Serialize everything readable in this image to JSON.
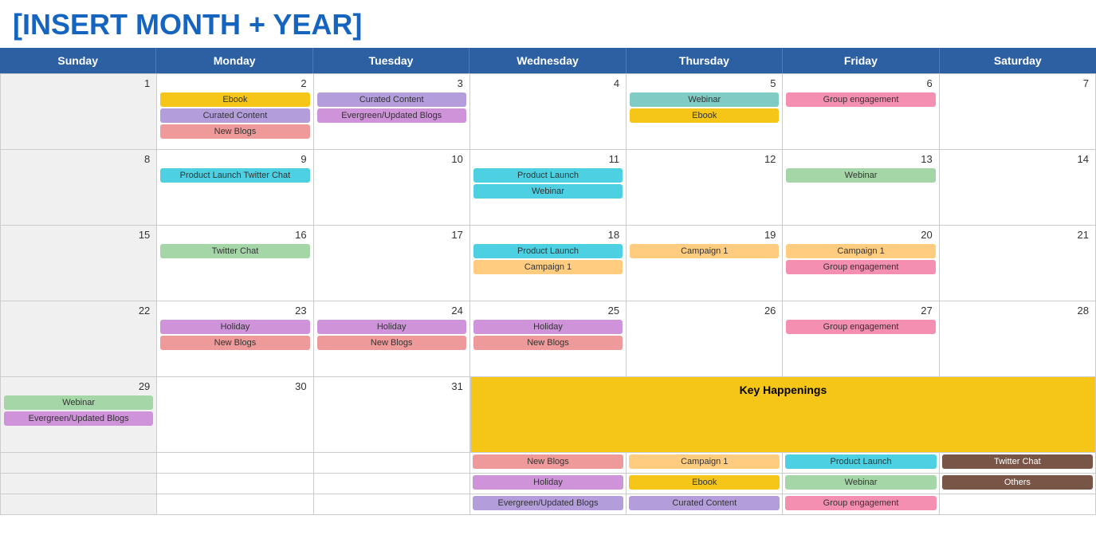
{
  "title": "[INSERT MONTH + YEAR]",
  "days": [
    "Sunday",
    "Monday",
    "Tuesday",
    "Wednesday",
    "Thursday",
    "Friday",
    "Saturday"
  ],
  "weeks": [
    {
      "cells": [
        {
          "date": "1",
          "events": []
        },
        {
          "date": "2",
          "events": [
            {
              "label": "Ebook",
              "color": "ev-yellow"
            },
            {
              "label": "Curated Content",
              "color": "ev-purple"
            },
            {
              "label": "New Blogs",
              "color": "ev-salmon"
            }
          ]
        },
        {
          "date": "3",
          "events": [
            {
              "label": "Curated Content",
              "color": "ev-purple"
            },
            {
              "label": "Evergreen/Updated Blogs",
              "color": "ev-lavender"
            }
          ]
        },
        {
          "date": "4",
          "events": []
        },
        {
          "date": "5",
          "events": [
            {
              "label": "Webinar",
              "color": "ev-green"
            },
            {
              "label": "Ebook",
              "color": "ev-yellow"
            }
          ]
        },
        {
          "date": "6",
          "events": [
            {
              "label": "Group engagement",
              "color": "ev-pink"
            }
          ]
        },
        {
          "date": "7",
          "events": []
        }
      ]
    },
    {
      "cells": [
        {
          "date": "8",
          "events": []
        },
        {
          "date": "9",
          "events": [
            {
              "label": "Product Launch Twitter Chat",
              "color": "ev-teal"
            }
          ]
        },
        {
          "date": "10",
          "events": []
        },
        {
          "date": "11",
          "events": [
            {
              "label": "Product Launch",
              "color": "ev-teal"
            },
            {
              "label": "Webinar",
              "color": "ev-teal"
            }
          ]
        },
        {
          "date": "12",
          "events": []
        },
        {
          "date": "13",
          "events": [
            {
              "label": "Webinar",
              "color": "ev-light-green"
            }
          ]
        },
        {
          "date": "14",
          "events": []
        }
      ]
    },
    {
      "cells": [
        {
          "date": "15",
          "events": []
        },
        {
          "date": "16",
          "events": [
            {
              "label": "Twitter Chat",
              "color": "ev-light-green"
            }
          ]
        },
        {
          "date": "17",
          "events": []
        },
        {
          "date": "18",
          "events": [
            {
              "label": "Product Launch",
              "color": "ev-teal"
            },
            {
              "label": "Campaign 1",
              "color": "ev-peach"
            }
          ]
        },
        {
          "date": "19",
          "events": [
            {
              "label": "Campaign 1",
              "color": "ev-peach"
            }
          ]
        },
        {
          "date": "20",
          "events": [
            {
              "label": "Campaign 1",
              "color": "ev-peach"
            },
            {
              "label": "Group engagement",
              "color": "ev-pink"
            }
          ]
        },
        {
          "date": "21",
          "events": []
        }
      ]
    },
    {
      "cells": [
        {
          "date": "22",
          "events": []
        },
        {
          "date": "23",
          "events": [
            {
              "label": "Holiday",
              "color": "ev-lavender"
            },
            {
              "label": "New Blogs",
              "color": "ev-salmon"
            }
          ]
        },
        {
          "date": "24",
          "events": [
            {
              "label": "Holiday",
              "color": "ev-lavender"
            },
            {
              "label": "New Blogs",
              "color": "ev-salmon"
            }
          ]
        },
        {
          "date": "25",
          "events": [
            {
              "label": "Holiday",
              "color": "ev-lavender"
            },
            {
              "label": "New Blogs",
              "color": "ev-salmon"
            }
          ]
        },
        {
          "date": "26",
          "events": []
        },
        {
          "date": "27",
          "events": [
            {
              "label": "Group engagement",
              "color": "ev-pink"
            }
          ]
        },
        {
          "date": "28",
          "events": []
        }
      ]
    }
  ],
  "week5_left": [
    {
      "date": "29",
      "events": [
        {
          "label": "Webinar",
          "color": "ev-light-green"
        },
        {
          "label": "Evergreen/Updated Blogs",
          "color": "ev-lavender"
        }
      ]
    },
    {
      "date": "30",
      "events": []
    },
    {
      "date": "31",
      "events": []
    }
  ],
  "key_happenings_label": "Key Happenings",
  "kh_rows": [
    [
      {
        "label": "New Blogs",
        "color": "ev-salmon"
      },
      {
        "label": "Campaign 1",
        "color": "ev-peach"
      },
      {
        "label": "Product Launch",
        "color": "ev-teal"
      },
      {
        "label": "Twitter Chat",
        "color": "ev-dark-brown"
      }
    ],
    [
      {
        "label": "Holiday",
        "color": "ev-lavender"
      },
      {
        "label": "Ebook",
        "color": "ev-yellow"
      },
      {
        "label": "Webinar",
        "color": "ev-light-green"
      },
      {
        "label": "Others",
        "color": "ev-dark-brown"
      }
    ],
    [
      {
        "label": "Evergreen/Updated Blogs",
        "color": "ev-purple"
      },
      {
        "label": "Curated Content",
        "color": "ev-purple"
      },
      {
        "label": "Group engagement",
        "color": "ev-pink"
      },
      {
        "label": "",
        "color": ""
      }
    ]
  ]
}
